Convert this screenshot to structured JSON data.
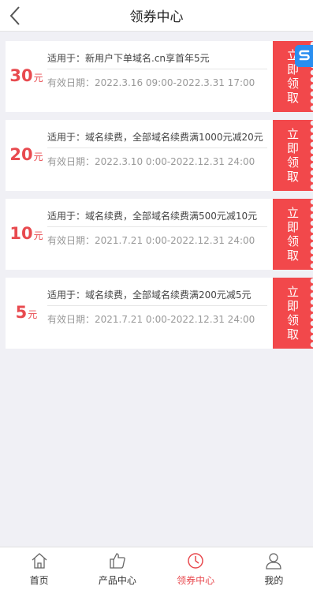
{
  "header": {
    "title": "领券中心"
  },
  "float_badge": {
    "icon": "s-logo-icon"
  },
  "coupons": [
    {
      "amount": "30",
      "unit": "元",
      "scope": "适用于：新用户下单域名.cn享首年5元",
      "valid": "有效日期：2022.3.16 09:00-2022.3.31 17:00",
      "claim": "立即领取"
    },
    {
      "amount": "20",
      "unit": "元",
      "scope": "适用于：域名续费，全部域名续费满1000元减20元",
      "valid": "有效日期：2022.3.10 0:00-2022.12.31 24:00",
      "claim": "立即领取"
    },
    {
      "amount": "10",
      "unit": "元",
      "scope": "适用于：域名续费，全部域名续费满500元减10元",
      "valid": "有效日期：2021.7.21 0:00-2022.12.31 24:00",
      "claim": "立即领取"
    },
    {
      "amount": "5",
      "unit": "元",
      "scope": "适用于：域名续费，全部域名续费满200元减5元",
      "valid": "有效日期：2021.7.21 0:00-2022.12.31 24:00",
      "claim": "立即领取"
    }
  ],
  "tabbar": [
    {
      "label": "首页",
      "icon": "home-icon",
      "active": false
    },
    {
      "label": "产品中心",
      "icon": "thumbs-up-icon",
      "active": false
    },
    {
      "label": "领券中心",
      "icon": "clock-icon",
      "active": true
    },
    {
      "label": "我的",
      "icon": "user-icon",
      "active": false
    }
  ],
  "colors": {
    "accent": "#f2484b",
    "amount": "#e84a4f",
    "badge": "#2a8ef0"
  }
}
